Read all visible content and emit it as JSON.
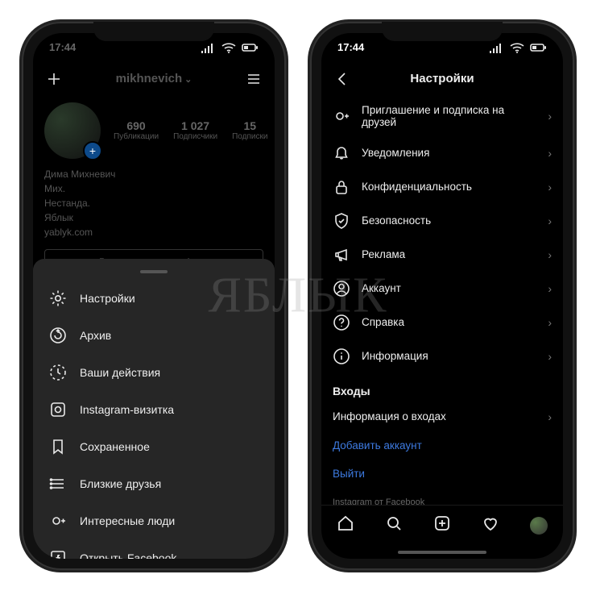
{
  "status": {
    "time": "17:44"
  },
  "left": {
    "username": "mikhnevich",
    "stats": [
      {
        "num": "690",
        "lbl": "Публикации"
      },
      {
        "num": "1 027",
        "lbl": "Подписчики"
      },
      {
        "num": "15",
        "lbl": "Подписки"
      }
    ],
    "bio": {
      "name": "Дима Михневич",
      "l1": "Мих.",
      "l2": "Нестанда.",
      "l3": "Яблык",
      "l4": "yablyk.com"
    },
    "edit": "Редактировать профиль",
    "menu": [
      {
        "icon": "gear",
        "label": "Настройки"
      },
      {
        "icon": "archive",
        "label": "Архив"
      },
      {
        "icon": "activity",
        "label": "Ваши действия"
      },
      {
        "icon": "nametag",
        "label": "Instagram-визитка"
      },
      {
        "icon": "bookmark",
        "label": "Сохраненное"
      },
      {
        "icon": "closefriends",
        "label": "Близкие друзья"
      },
      {
        "icon": "discover",
        "label": "Интересные люди"
      },
      {
        "icon": "facebook",
        "label": "Открыть Facebook"
      }
    ]
  },
  "right": {
    "title": "Настройки",
    "items": [
      {
        "icon": "discover",
        "label": "Приглашение и подписка на друзей"
      },
      {
        "icon": "bell",
        "label": "Уведомления"
      },
      {
        "icon": "lock",
        "label": "Конфиденциальность"
      },
      {
        "icon": "shield",
        "label": "Безопасность"
      },
      {
        "icon": "megaphone",
        "label": "Реклама"
      },
      {
        "icon": "account",
        "label": "Аккаунт"
      },
      {
        "icon": "help",
        "label": "Справка"
      },
      {
        "icon": "info",
        "label": "Информация"
      }
    ],
    "logins_header": "Входы",
    "login_info": "Информация о входах",
    "add_account": "Добавить аккаунт",
    "logout": "Выйти",
    "footer": "Instagram от Facebook"
  },
  "watermark": "ЯБЛЫК"
}
